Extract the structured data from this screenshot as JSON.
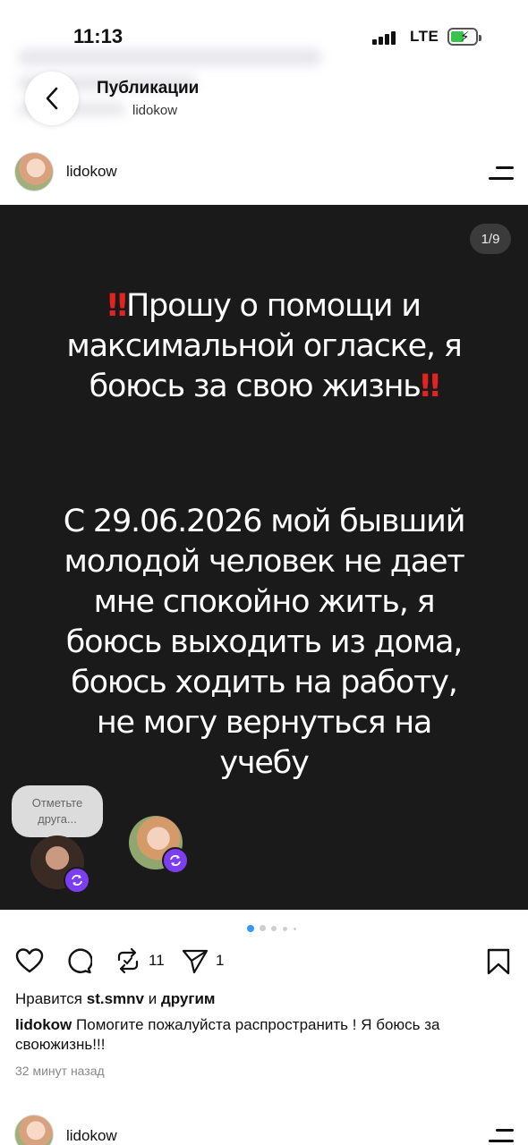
{
  "status": {
    "time": "11:13",
    "network": "LTE"
  },
  "header": {
    "title": "Публикации",
    "subtitle": "lidokow"
  },
  "post": {
    "username": "lidokow",
    "page_counter": "1/9",
    "text_block_1": [
      "Прошу о помощи и",
      "максимальной огласке, я",
      "боюсь за свою жизнь"
    ],
    "text_block_2": [
      "С 29.06.2026 мой бывший",
      "молодой человек не дает",
      "мне спокойно жить, я",
      "боюсь выходить из дома,",
      "боюсь ходить на работу,",
      "не могу вернуться на",
      "учебу"
    ],
    "tag_prompt": "Отметьте друга...",
    "carousel_total": 5,
    "carousel_active": 1,
    "repost_count": "11",
    "share_count": "1",
    "likes_prefix": "Нравится",
    "likes_user": "st.smnv",
    "likes_and": "и",
    "likes_others": "другим",
    "caption_user": "lidokow",
    "caption_text": "Помогите пожалуйста распространить ! Я боюсь за своюжизнь!!!",
    "time_ago": "32 минут назад"
  },
  "next_post": {
    "username": "lidokow"
  },
  "colors": {
    "alert_red": "#e3231f",
    "badge_purple": "#7b3ef0",
    "carousel_active": "#3897f0"
  }
}
